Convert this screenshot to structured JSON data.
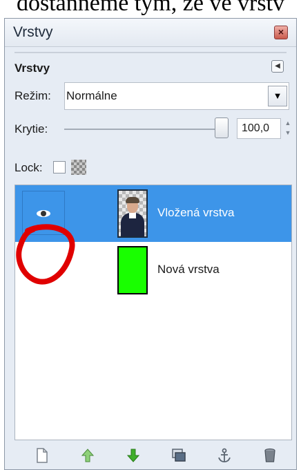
{
  "document_text": "dostanneme tým, že ve vrstv",
  "panel": {
    "title": "Vrstvy",
    "close_icon": "close-icon"
  },
  "section": {
    "title": "Vrstvy",
    "mode_label": "Režim:",
    "mode_value": "Normálne",
    "opacity_label": "Krytie:",
    "opacity_value": "100,0",
    "opacity_percent": 100,
    "lock_label": "Lock:",
    "lock_checked": false
  },
  "layers": [
    {
      "name": "Vložená vrstva",
      "visible": true,
      "selected": true,
      "thumbnail": "portrait-photo"
    },
    {
      "name": "Nová vrstva",
      "visible": false,
      "selected": false,
      "thumbnail": "green-fill",
      "color": "#19ff00"
    }
  ],
  "toolbar": {
    "icons": [
      "new-layer-icon",
      "raise-layer-icon",
      "lower-layer-icon",
      "duplicate-layer-icon",
      "anchor-layer-icon",
      "delete-layer-icon"
    ]
  },
  "colors": {
    "selection": "#3d95e9",
    "annotation": "#e00000",
    "raise_green": "#8fd17a",
    "lower_green": "#3fae2a"
  }
}
